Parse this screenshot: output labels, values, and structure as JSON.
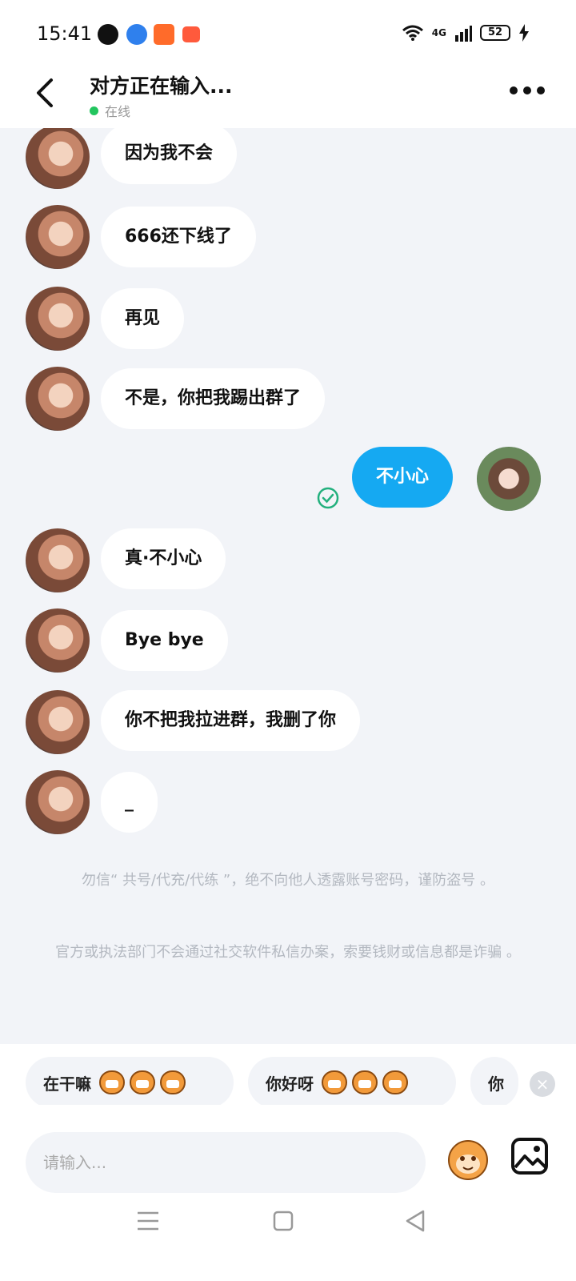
{
  "status_bar": {
    "time": "15:41",
    "network": "4G",
    "battery": "52"
  },
  "header": {
    "title": "对方正在输入...",
    "status": "在线"
  },
  "messages": [
    {
      "side": "left",
      "text": "因为我不会"
    },
    {
      "side": "left",
      "text": "666还下线了"
    },
    {
      "side": "left",
      "text": "再见"
    },
    {
      "side": "left",
      "text": "不是，你把我踢出群了"
    },
    {
      "side": "right",
      "text": "不小心"
    },
    {
      "side": "left",
      "text": "真·不小心"
    },
    {
      "side": "left",
      "text": "Bye bye"
    },
    {
      "side": "left",
      "text": "你不把我拉进群，我删了你"
    },
    {
      "side": "left",
      "text": "_"
    }
  ],
  "notices": {
    "line1": "勿信“ 共号/代充/代练 ”，绝不向他人透露账号密码，谨防盗号 。",
    "line2": "官方或执法部门不会通过社交软件私信办案，索要钱财或信息都是诈骗 。"
  },
  "suggestions": [
    "在干嘛",
    "你好呀",
    "你"
  ],
  "input": {
    "placeholder": "请输入..."
  },
  "colors": {
    "accent": "#15a9f2",
    "background": "#f2f4f8",
    "online": "#22c55e"
  }
}
